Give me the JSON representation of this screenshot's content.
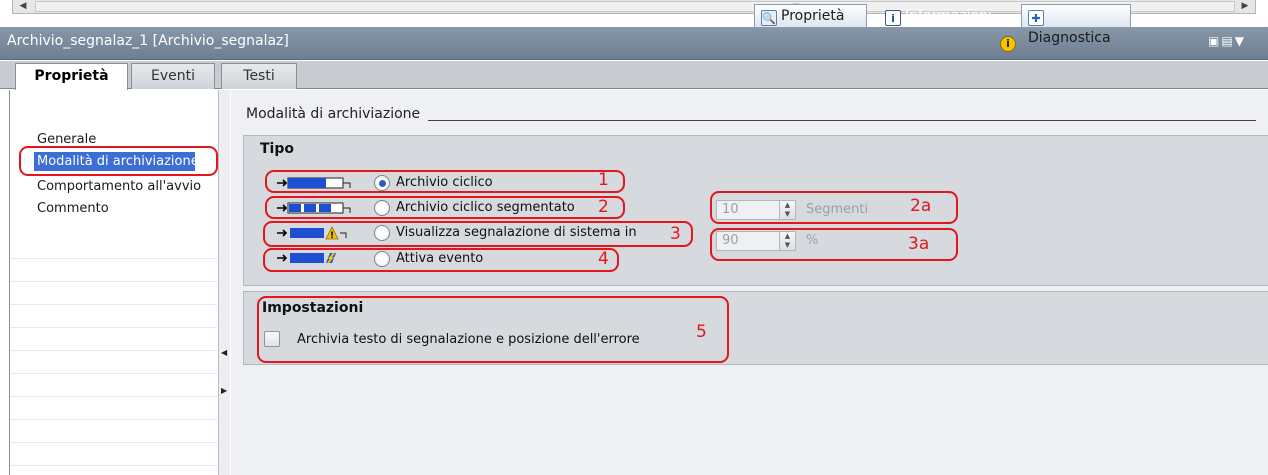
{
  "window": {
    "title": "Archivio_segnalaz_1 [Archivio_segnalaz]",
    "inspector_buttons": [
      {
        "label": "Proprietà",
        "icon": "properties-icon",
        "active": true
      },
      {
        "label": "Informazioni",
        "icon": "info-icon",
        "active": false
      },
      {
        "label": "Diagnostica",
        "icon": "diagnostics-icon",
        "active": true
      }
    ],
    "info_badge": "i",
    "scroll_grip": "III"
  },
  "tabs": [
    {
      "label": "Proprietà",
      "active": true
    },
    {
      "label": "Eventi",
      "active": false
    },
    {
      "label": "Testi",
      "active": false
    }
  ],
  "nav": {
    "items": [
      {
        "label": "Generale",
        "selected": false
      },
      {
        "label": "Modalità di archiviazione",
        "selected": true
      },
      {
        "label": "Comportamento all'avvio",
        "selected": false
      },
      {
        "label": "Commento",
        "selected": false
      }
    ]
  },
  "section": {
    "title": "Modalità di archiviazione",
    "tipo": {
      "title": "Tipo",
      "options": [
        {
          "label": "Archivio ciclico",
          "selected": true,
          "callout": "1",
          "icon": "cyclic-archive-icon"
        },
        {
          "label": "Archivio ciclico segmentato",
          "selected": false,
          "callout": "2",
          "icon": "segmented-archive-icon"
        },
        {
          "label": "Visualizza segnalazione di sistema in",
          "selected": false,
          "callout": "3",
          "icon": "system-alarm-icon"
        },
        {
          "label": "Attiva evento",
          "selected": false,
          "callout": "4",
          "icon": "trigger-event-icon"
        }
      ],
      "segments": {
        "value": "10",
        "unit": "Segmenti",
        "callout": "2a"
      },
      "percent": {
        "value": "90",
        "unit": "%",
        "callout": "3a"
      }
    },
    "impostazioni": {
      "title": "Impostazioni",
      "checkbox_label": "Archivia testo di segnalazione e posizione dell'errore",
      "checked": false,
      "callout": "5"
    }
  },
  "colors": {
    "accent": "#3c6ed4",
    "callout": "#e3161b",
    "titlebar": "#7b8b9d"
  }
}
